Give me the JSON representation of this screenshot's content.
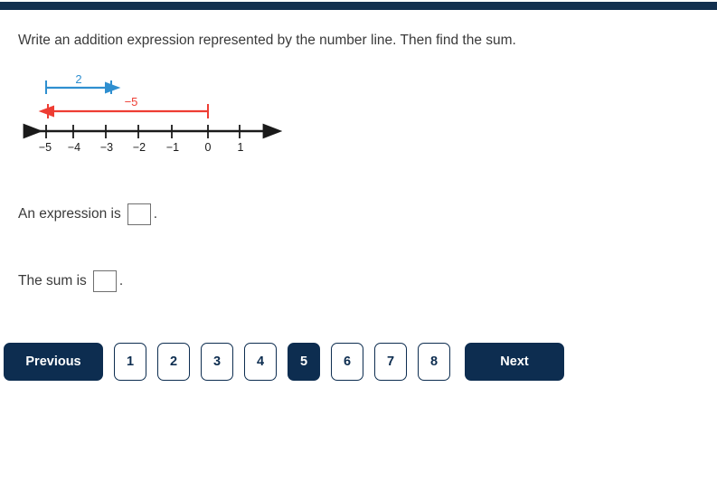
{
  "theme": {
    "navy": "#0d2d50",
    "bar_navy": "#12304f",
    "blue": "#2f8fd0",
    "red": "#ee3d33",
    "text": "#3a3a3a"
  },
  "prompt": {
    "text": "Write an addition expression represented by the number line. Then find the sum."
  },
  "figure": {
    "name": "number-line-diagram",
    "axis": {
      "min_label": -5,
      "max_label": 1,
      "tick_labels": [
        "−5",
        "−4",
        "−3",
        "−2",
        "−1",
        "0",
        "1"
      ],
      "tick_values": [
        -5,
        -4,
        -3,
        -2,
        -1,
        0,
        1
      ]
    },
    "arrows": [
      {
        "name": "blue-arrow",
        "label": "2",
        "color": "#2f8fd0",
        "start": -5,
        "end": -3,
        "direction": "right"
      },
      {
        "name": "red-arrow",
        "label": "−5",
        "color": "#ee3d33",
        "start": 0,
        "end": -5,
        "direction": "left"
      }
    ]
  },
  "answers": {
    "expression": {
      "prefix": "An expression is",
      "suffix": ".",
      "value": "",
      "placeholder": ""
    },
    "sum": {
      "prefix": "The sum is",
      "suffix": ".",
      "value": "",
      "placeholder": ""
    }
  },
  "pager": {
    "previous_label": "Previous",
    "next_label": "Next",
    "pages": [
      "1",
      "2",
      "3",
      "4",
      "5",
      "6",
      "7",
      "8"
    ],
    "active_page": "5"
  }
}
